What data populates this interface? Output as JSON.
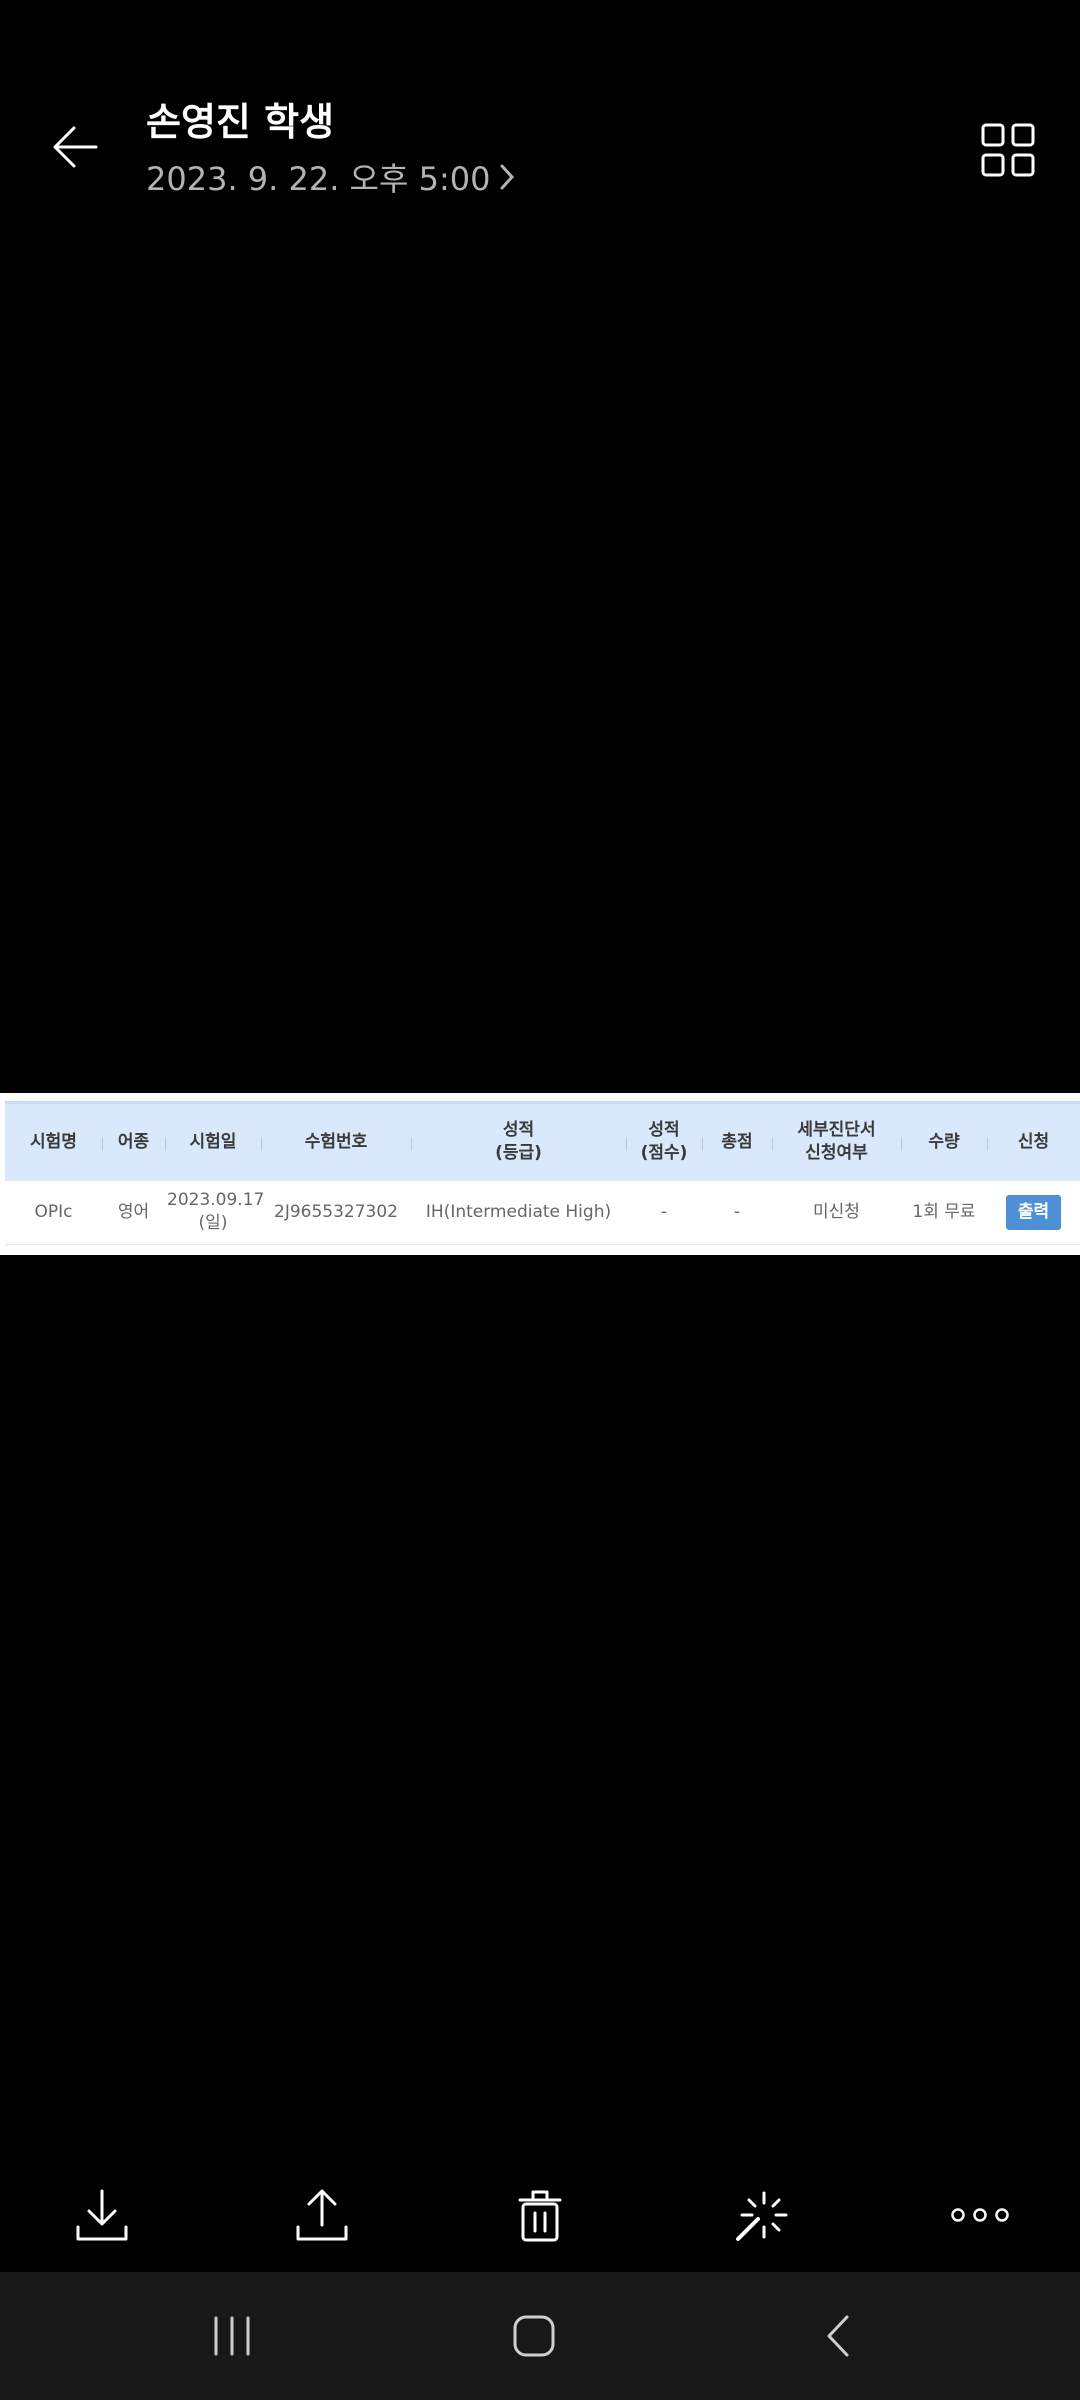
{
  "header": {
    "title": "손영진 학생",
    "subtitle": "2023. 9. 22. 오후 5:00"
  },
  "table": {
    "headers": [
      [
        "시험명"
      ],
      [
        "어종"
      ],
      [
        "시험일"
      ],
      [
        "수험번호"
      ],
      [
        "성적",
        "(등급)"
      ],
      [
        "성적",
        "(점수)"
      ],
      [
        "총점"
      ],
      [
        "세부진단서",
        "신청여부"
      ],
      [
        "수량"
      ],
      [
        "신청"
      ]
    ],
    "row": {
      "exam": "OPIc",
      "language": "영어",
      "date_line1": "2023.09.17",
      "date_line2": "(일)",
      "reg_no": "2J9655327302",
      "grade": "IH(Intermediate High)",
      "score": "-",
      "total": "-",
      "diag_status": "미신청",
      "quantity": "1회 무료",
      "print_label": "출력"
    }
  },
  "icons": {
    "back": "arrow-left-icon",
    "grid": "grid-icon",
    "download": "download-icon",
    "share": "share-icon",
    "delete": "trash-icon",
    "enhance": "magic-wand-icon",
    "more": "more-icon"
  },
  "colors": {
    "header_bg": "#d9e8fb",
    "print_button": "#4f8fd6",
    "navbar_bg": "#181818"
  }
}
